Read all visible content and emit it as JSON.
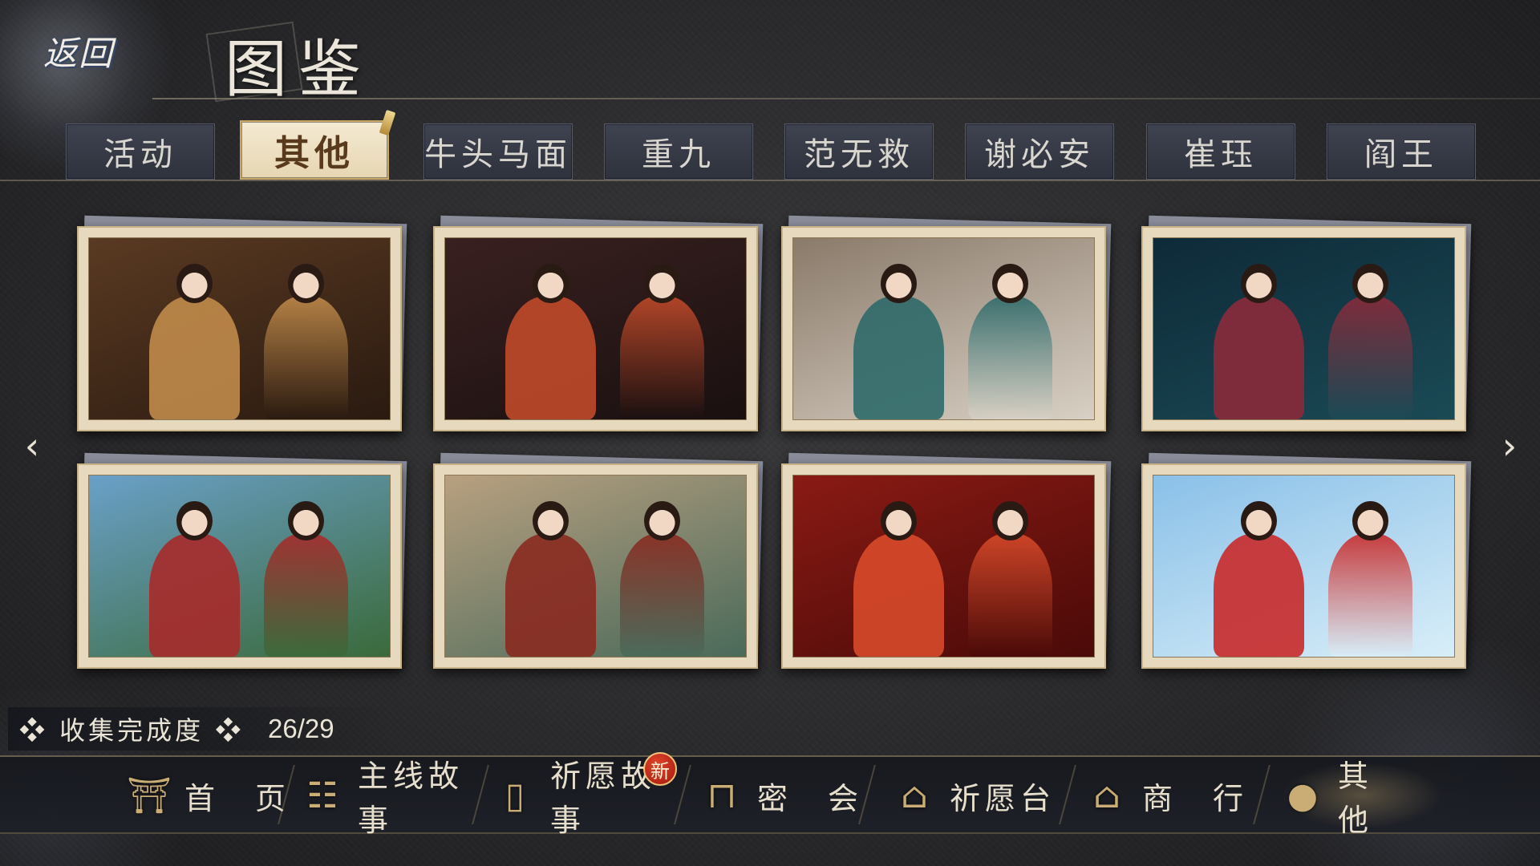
{
  "header": {
    "back_label": "返回",
    "title": "图鉴"
  },
  "tabs": [
    {
      "label": "活动",
      "active": false
    },
    {
      "label": "其他",
      "active": true
    },
    {
      "label": "牛头马面",
      "active": false
    },
    {
      "label": "重九",
      "active": false
    },
    {
      "label": "范无救",
      "active": false
    },
    {
      "label": "谢必安",
      "active": false
    },
    {
      "label": "崔珏",
      "active": false
    },
    {
      "label": "阎王",
      "active": false
    }
  ],
  "gallery": {
    "prev_icon": "chevron-left-icon",
    "next_icon": "chevron-right-icon",
    "cards": [
      {
        "scene": "throne-hall",
        "palette": [
          "#5a3a22",
          "#2a1a10",
          "#c08a4a"
        ]
      },
      {
        "scene": "underworld-gathering",
        "palette": [
          "#3a2020",
          "#1a1010",
          "#c04a2a"
        ]
      },
      {
        "scene": "tea-lattice-window",
        "palette": [
          "#8a7a6a",
          "#d8d0c4",
          "#2e6a6a"
        ]
      },
      {
        "scene": "night-garden",
        "palette": [
          "#0e2a38",
          "#1a4a55",
          "#8a2a3a"
        ]
      },
      {
        "scene": "mountain-cliff",
        "palette": [
          "#6aa0c8",
          "#3a6a3a",
          "#a82a2a"
        ]
      },
      {
        "scene": "courtyard",
        "palette": [
          "#b8a080",
          "#4a6a5a",
          "#8a2a20"
        ]
      },
      {
        "scene": "wedding-chamber",
        "palette": [
          "#8a1a14",
          "#4a0a08",
          "#d84a2a"
        ]
      },
      {
        "scene": "horse-ride",
        "palette": [
          "#8ac0e8",
          "#d8eef8",
          "#c82a2a"
        ]
      }
    ]
  },
  "collection": {
    "label": "❖ 收集完成度 ❖",
    "value": "26/29"
  },
  "bottom_nav": {
    "new_badge": "新",
    "items": [
      {
        "label": "首　页",
        "icon": "gate-icon"
      },
      {
        "label": "主线故事",
        "icon": "scroll-icon"
      },
      {
        "label": "祈愿故事",
        "icon": "talisman-icon"
      },
      {
        "label": "密　会",
        "icon": "table-icon"
      },
      {
        "label": "祈愿台",
        "icon": "shrine-icon"
      },
      {
        "label": "商　行",
        "icon": "shop-icon"
      },
      {
        "label": "其　他",
        "icon": "pouch-icon"
      }
    ]
  }
}
